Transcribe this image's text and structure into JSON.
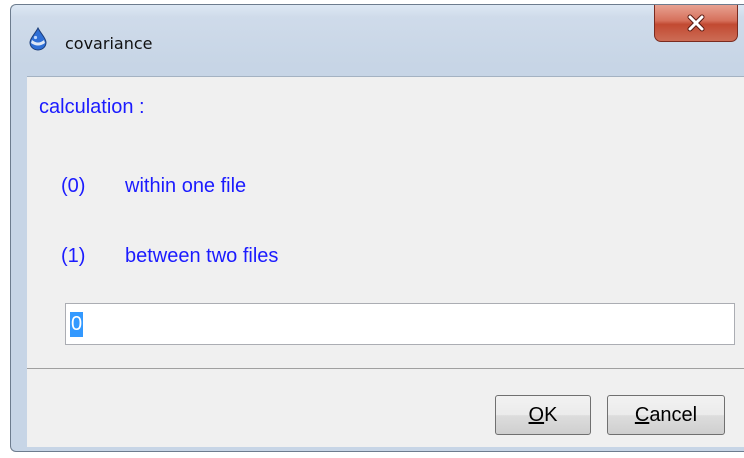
{
  "window": {
    "title": "covariance",
    "icon": "app-drop-icon",
    "close_icon": "close-icon"
  },
  "dialog": {
    "heading": "calculation :",
    "options": [
      {
        "index": "(0)",
        "label": "within one file"
      },
      {
        "index": "(1)",
        "label": "between two files"
      }
    ],
    "input_value": "0"
  },
  "buttons": {
    "ok": {
      "mnemonic": "O",
      "rest": "K"
    },
    "cancel": {
      "mnemonic": "C",
      "rest": "ancel"
    }
  },
  "colors": {
    "label_text": "#1b1bff",
    "selection": "#3399ff",
    "dialog_bg": "#f0f0f0",
    "close_button": "#c24a32"
  }
}
